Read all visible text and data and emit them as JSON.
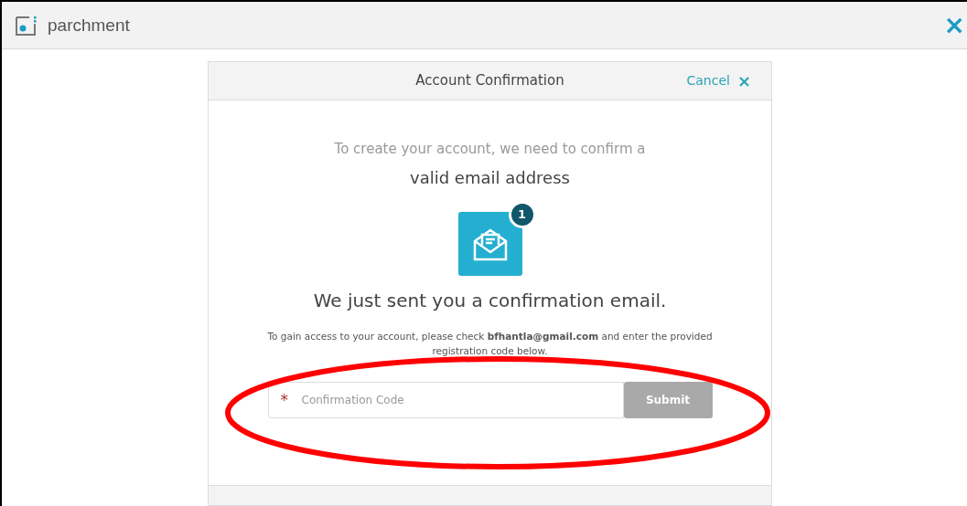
{
  "header": {
    "brand": "parchment",
    "close": "×"
  },
  "dialog": {
    "title": "Account Confirmation",
    "cancel": "Cancel",
    "cancel_icon": "×",
    "intro": "To create your account, we need to confirm a",
    "intro_strong": "valid email address",
    "badge": "1",
    "heading": "We just sent you a confirmation email.",
    "message": "To gain access to your account, please check **bfhantla@gmail.com** and enter the provided registration code below.",
    "field": {
      "required_mark": "*",
      "placeholder": "Confirmation Code"
    },
    "submit": {
      "label": "Submit",
      "disabled": true
    }
  },
  "annotation": {
    "kind": "ellipse",
    "color": "#ff0000"
  }
}
